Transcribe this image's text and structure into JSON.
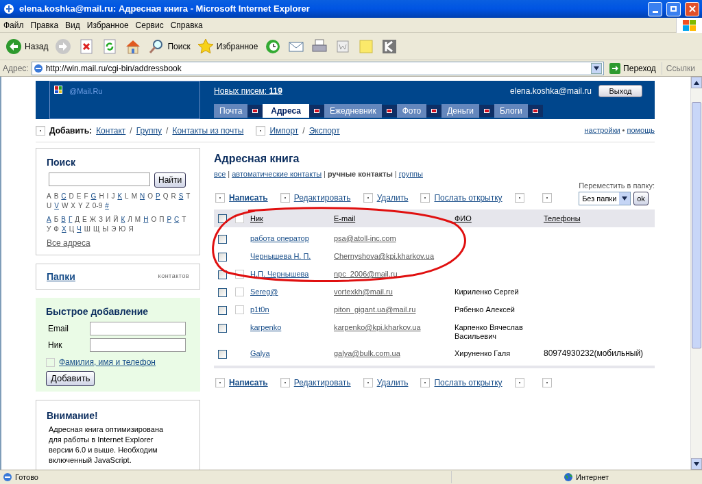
{
  "window": {
    "title": "elena.koshka@mail.ru: Адресная книга - Microsoft Internet Explorer"
  },
  "menu": [
    "Файл",
    "Правка",
    "Вид",
    "Избранное",
    "Сервис",
    "Справка"
  ],
  "toolbar": [
    {
      "kind": "back",
      "label": "Назад"
    },
    {
      "kind": "forward"
    },
    {
      "kind": "stop"
    },
    {
      "kind": "refresh"
    },
    {
      "kind": "home"
    },
    {
      "kind": "search",
      "label": "Поиск"
    },
    {
      "kind": "favorites",
      "label": "Избранное"
    },
    {
      "kind": "history"
    },
    {
      "kind": "mail"
    },
    {
      "kind": "print"
    },
    {
      "kind": "edit"
    },
    {
      "kind": "note"
    },
    {
      "kind": "k"
    }
  ],
  "address_bar": {
    "label": "Адрес:",
    "url": "http://win.mail.ru/cgi-bin/addressbook",
    "go": "Переход",
    "links": "Ссылки"
  },
  "header": {
    "logo": "@Mail.Ru",
    "new_mail_label": "Новых писем:",
    "new_mail_count": "119",
    "user": "elena.koshka@mail.ru",
    "logout": "Выход",
    "tabs": [
      {
        "label": "Почта",
        "selected": false
      },
      {
        "label": "Адреса",
        "selected": true
      },
      {
        "label": "Ежедневник",
        "selected": false
      },
      {
        "label": "Фото",
        "selected": false
      },
      {
        "label": "Деньги",
        "selected": false
      },
      {
        "label": "Блоги",
        "selected": false
      }
    ]
  },
  "add_bar": {
    "label": "Добавить:",
    "links": [
      {
        "label": "Контакт"
      },
      {
        "sep": "/",
        "label": "Группу"
      },
      {
        "sep": "/",
        "label": "Контакты из почты"
      }
    ],
    "io_links": [
      {
        "label": "Импорт"
      },
      {
        "sep": "/",
        "label": "Экспорт"
      }
    ],
    "right_links": [
      {
        "label": "настройки"
      },
      {
        "sep": "•",
        "label": "помощь"
      }
    ]
  },
  "search": {
    "title": "Поиск",
    "button": "Найти",
    "latin": [
      {
        "c": "A",
        "link": false
      },
      {
        "c": "B",
        "link": false
      },
      {
        "c": "C",
        "link": true
      },
      {
        "c": "D",
        "link": false
      },
      {
        "c": "E",
        "link": false
      },
      {
        "c": "F",
        "link": false
      },
      {
        "c": "G",
        "link": true
      },
      {
        "c": "H",
        "link": false
      },
      {
        "c": "I",
        "link": false
      },
      {
        "c": "J",
        "link": false
      },
      {
        "c": "K",
        "link": true
      },
      {
        "c": "L",
        "link": false
      },
      {
        "c": "M",
        "link": false
      },
      {
        "c": "N",
        "link": true
      },
      {
        "c": "O",
        "link": false
      },
      {
        "c": "P",
        "link": true
      },
      {
        "c": "Q",
        "link": false
      },
      {
        "c": "R",
        "link": false
      },
      {
        "c": "S",
        "link": true
      },
      {
        "c": "T",
        "link": false
      },
      {
        "c": "U",
        "link": false
      },
      {
        "c": "V",
        "link": true
      },
      {
        "c": "W",
        "link": false
      },
      {
        "c": "X",
        "link": false
      },
      {
        "c": "Y",
        "link": false
      },
      {
        "c": "Z",
        "link": false
      },
      {
        "c": "0-9",
        "link": false
      },
      {
        "c": "#",
        "link": true
      }
    ],
    "cyrillic": [
      {
        "c": "А",
        "link": true
      },
      {
        "c": "Б",
        "link": false
      },
      {
        "c": "В",
        "link": true
      },
      {
        "c": "Г",
        "link": true
      },
      {
        "c": "Д",
        "link": false
      },
      {
        "c": "Е",
        "link": false
      },
      {
        "c": "Ж",
        "link": false
      },
      {
        "c": "З",
        "link": false
      },
      {
        "c": "И",
        "link": false
      },
      {
        "c": "Й",
        "link": false
      },
      {
        "c": "К",
        "link": true
      },
      {
        "c": "Л",
        "link": false
      },
      {
        "c": "М",
        "link": false
      },
      {
        "c": "Н",
        "link": true
      },
      {
        "c": "О",
        "link": false
      },
      {
        "c": "П",
        "link": false
      },
      {
        "c": "Р",
        "link": true
      },
      {
        "c": "С",
        "link": true
      },
      {
        "c": "Т",
        "link": false
      },
      {
        "c": "У",
        "link": false
      },
      {
        "c": "Ф",
        "link": false
      },
      {
        "c": "Х",
        "link": true
      },
      {
        "c": "Ц",
        "link": false
      },
      {
        "c": "Ч",
        "link": true
      },
      {
        "c": "Ш",
        "link": false
      },
      {
        "c": "Щ",
        "link": false
      },
      {
        "c": "Ы",
        "link": false
      },
      {
        "c": "Э",
        "link": false
      },
      {
        "c": "Ю",
        "link": false
      },
      {
        "c": "Я",
        "link": false
      }
    ],
    "all": "Все адреса"
  },
  "folders": {
    "title": "Папки",
    "note": "контактов"
  },
  "quick_add": {
    "title": "Быстрое добавление",
    "fields": [
      {
        "label": "Email"
      },
      {
        "label": "Ник"
      }
    ],
    "checkbox": {
      "label": "Фамилия, имя и телефон",
      "checked": false
    },
    "button": "Добавить"
  },
  "notice": {
    "title": "Внимание!",
    "text": "Адресная книга оптимизирована для работы в Internet Explorer версии 6.0 и выше. Необходим включенный JavaScript."
  },
  "addressbook": {
    "title": "Адресная книга",
    "filters": [
      {
        "label": "все",
        "selected": false
      },
      {
        "sep": "|",
        "label": "автоматические контакты",
        "selected": false
      },
      {
        "sep": "|",
        "label": "ручные контакты",
        "selected": true
      },
      {
        "sep": "|",
        "label": "группы",
        "selected": false
      }
    ],
    "actions": [
      {
        "label": "Написать",
        "primary": true
      },
      {
        "label": "Редактировать",
        "primary": false
      },
      {
        "label": "Удалить",
        "primary": false
      },
      {
        "label": "Послать открытку",
        "primary": false
      }
    ],
    "move": {
      "label": "Переместить в папку:",
      "value": "Без папки",
      "button": "ok"
    },
    "header_checked": false,
    "header_second_checked": false,
    "columns": [
      "Ник",
      "E-mail",
      "ФИО",
      "Телефоны"
    ],
    "rows": [
      {
        "checked": false,
        "second_box": false,
        "nick": "работа оператор",
        "email": "psa@atoll-inc.com"
      },
      {
        "checked": false,
        "second_box": false,
        "nick": "Чернышева Н. П.",
        "email": "Chernyshova@kpi.kharkov.ua"
      },
      {
        "checked": false,
        "second_box": true,
        "nick": "Н.П. Чернышева",
        "email": "npc_2006@mail.ru"
      },
      {
        "checked": false,
        "second_box": true,
        "nick": "Sereg@",
        "email": "vortexkh@mail.ru",
        "name": "Кириленко Сергей"
      },
      {
        "checked": false,
        "second_box": true,
        "nick": "p1t0n",
        "email": "piton_gigant.ua@mail.ru",
        "name": "Рябенко Алексей"
      },
      {
        "checked": false,
        "second_box": false,
        "nick": "karpenko",
        "email": "karpenko@kpi.kharkov.ua",
        "name": "Карпенко Вячеслав Васильевич"
      },
      {
        "checked": false,
        "second_box": false,
        "nick": "Galya",
        "email": "galya@bulk.com.ua",
        "name": "Хируненко Галя",
        "phone": "80974930232(мобильный)"
      }
    ],
    "bottom_actions": [
      {
        "label": "Написать",
        "primary": true
      },
      {
        "label": "Редактировать",
        "primary": false
      },
      {
        "label": "Удалить",
        "primary": false
      },
      {
        "label": "Послать открытку",
        "primary": false
      }
    ]
  },
  "status_bar": {
    "text": "Готово",
    "zone": "Интернет"
  }
}
